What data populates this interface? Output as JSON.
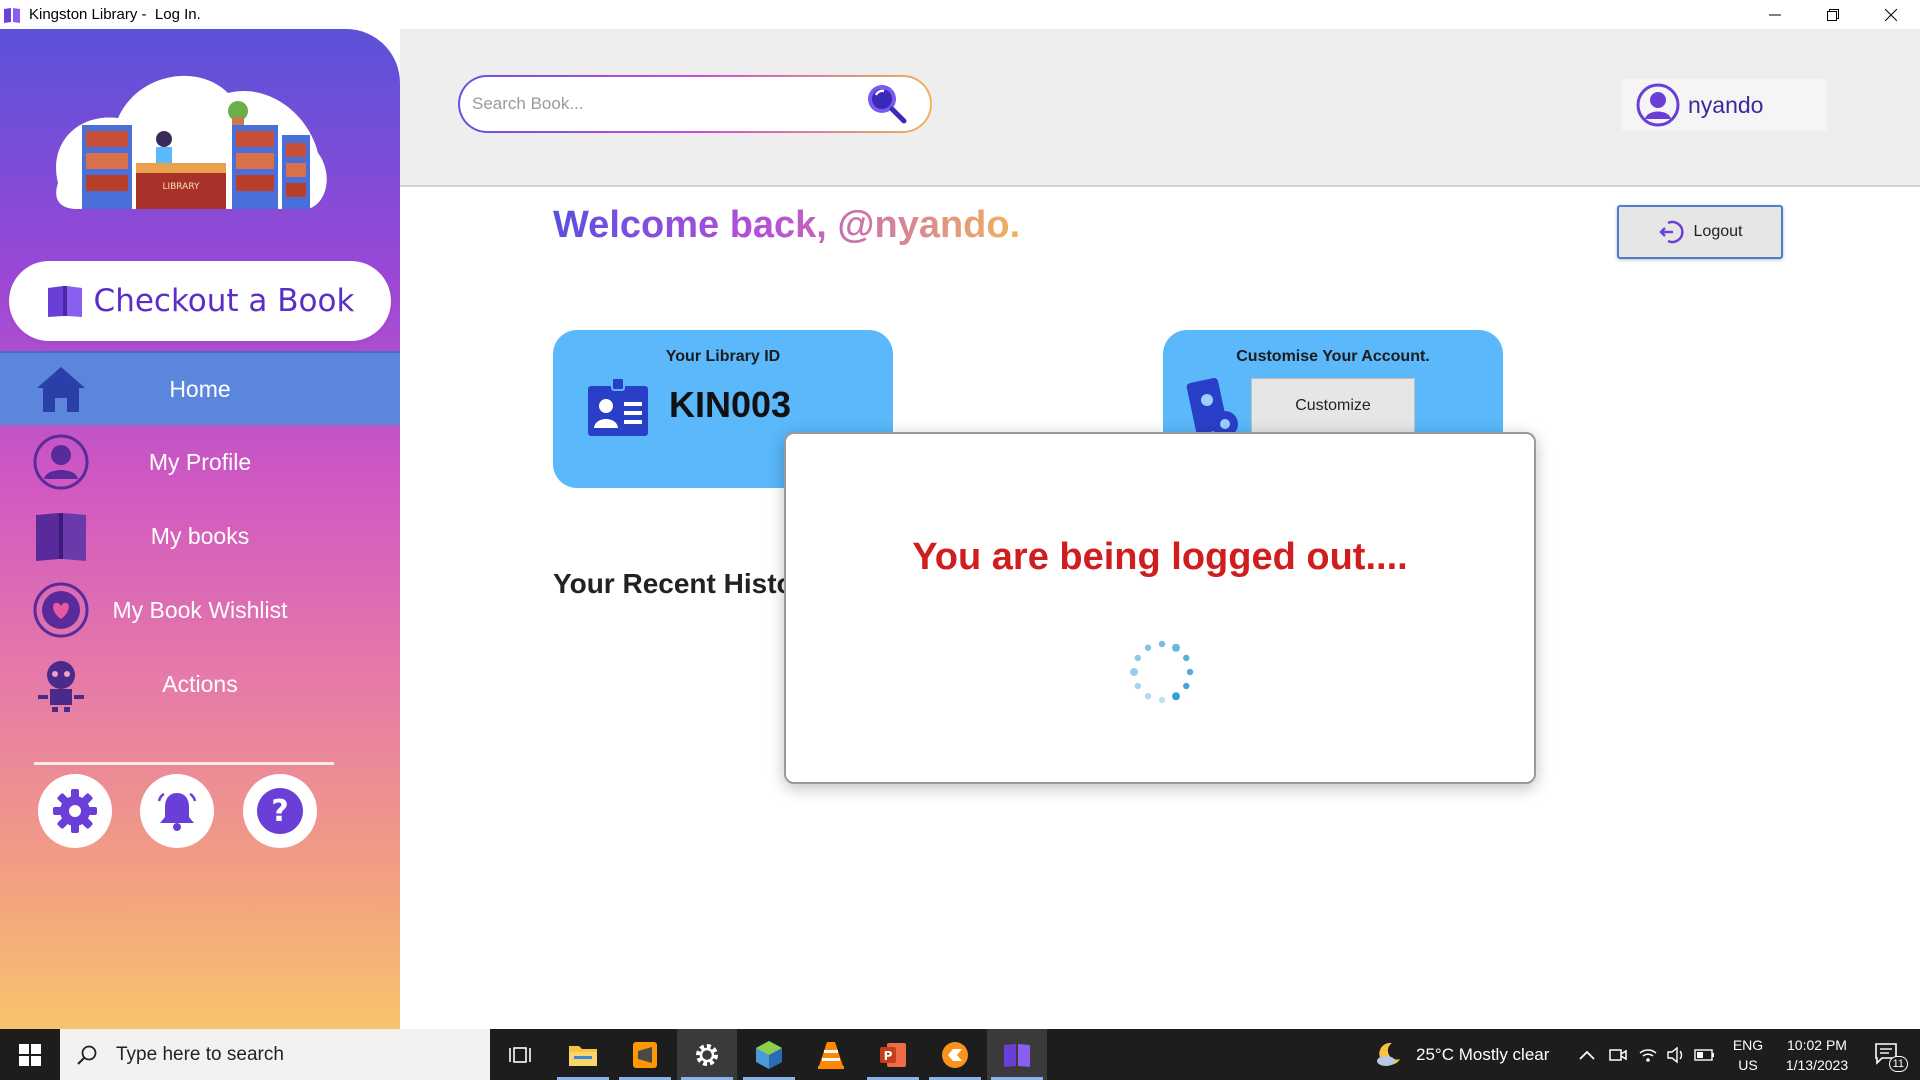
{
  "window": {
    "title": "Kingston Library -  Log In.",
    "controls": [
      "minimize",
      "restore",
      "close"
    ]
  },
  "sidebar": {
    "illustration_label": "LIBRARY",
    "checkout_label": "Checkout a Book",
    "items": [
      {
        "label": "Home",
        "icon": "home-icon",
        "active": true
      },
      {
        "label": "My Profile",
        "icon": "user-icon",
        "active": false
      },
      {
        "label": "My books",
        "icon": "book-icon",
        "active": false
      },
      {
        "label": "My Book Wishlist",
        "icon": "heart-icon",
        "active": false
      },
      {
        "label": "Actions",
        "icon": "robot-icon",
        "active": false
      }
    ],
    "bottom_buttons": [
      "settings-icon",
      "bell-icon",
      "help-icon"
    ]
  },
  "header": {
    "search_placeholder": "Search Book...",
    "username": "nyando"
  },
  "main": {
    "welcome": "Welcome back, @nyando.",
    "logout_label": "Logout",
    "library_id_card": {
      "title": "Your Library ID",
      "value": "KIN003"
    },
    "customize_card": {
      "title": "Customise Your Account.",
      "button": "Customize"
    },
    "recent_history_title": "Your Recent History"
  },
  "modal": {
    "message": "You are being logged out...."
  },
  "taskbar": {
    "search_placeholder": "Type here to search",
    "weather": "25°C  Mostly clear",
    "language": "ENG",
    "region": "US",
    "time": "10:02 PM",
    "date": "1/13/2023",
    "notification_count": "11"
  },
  "colors": {
    "accent": "#5b2ec8",
    "card": "#5ab8fb",
    "logout_message": "#d01d1d",
    "active_nav": "#5b86dc"
  }
}
